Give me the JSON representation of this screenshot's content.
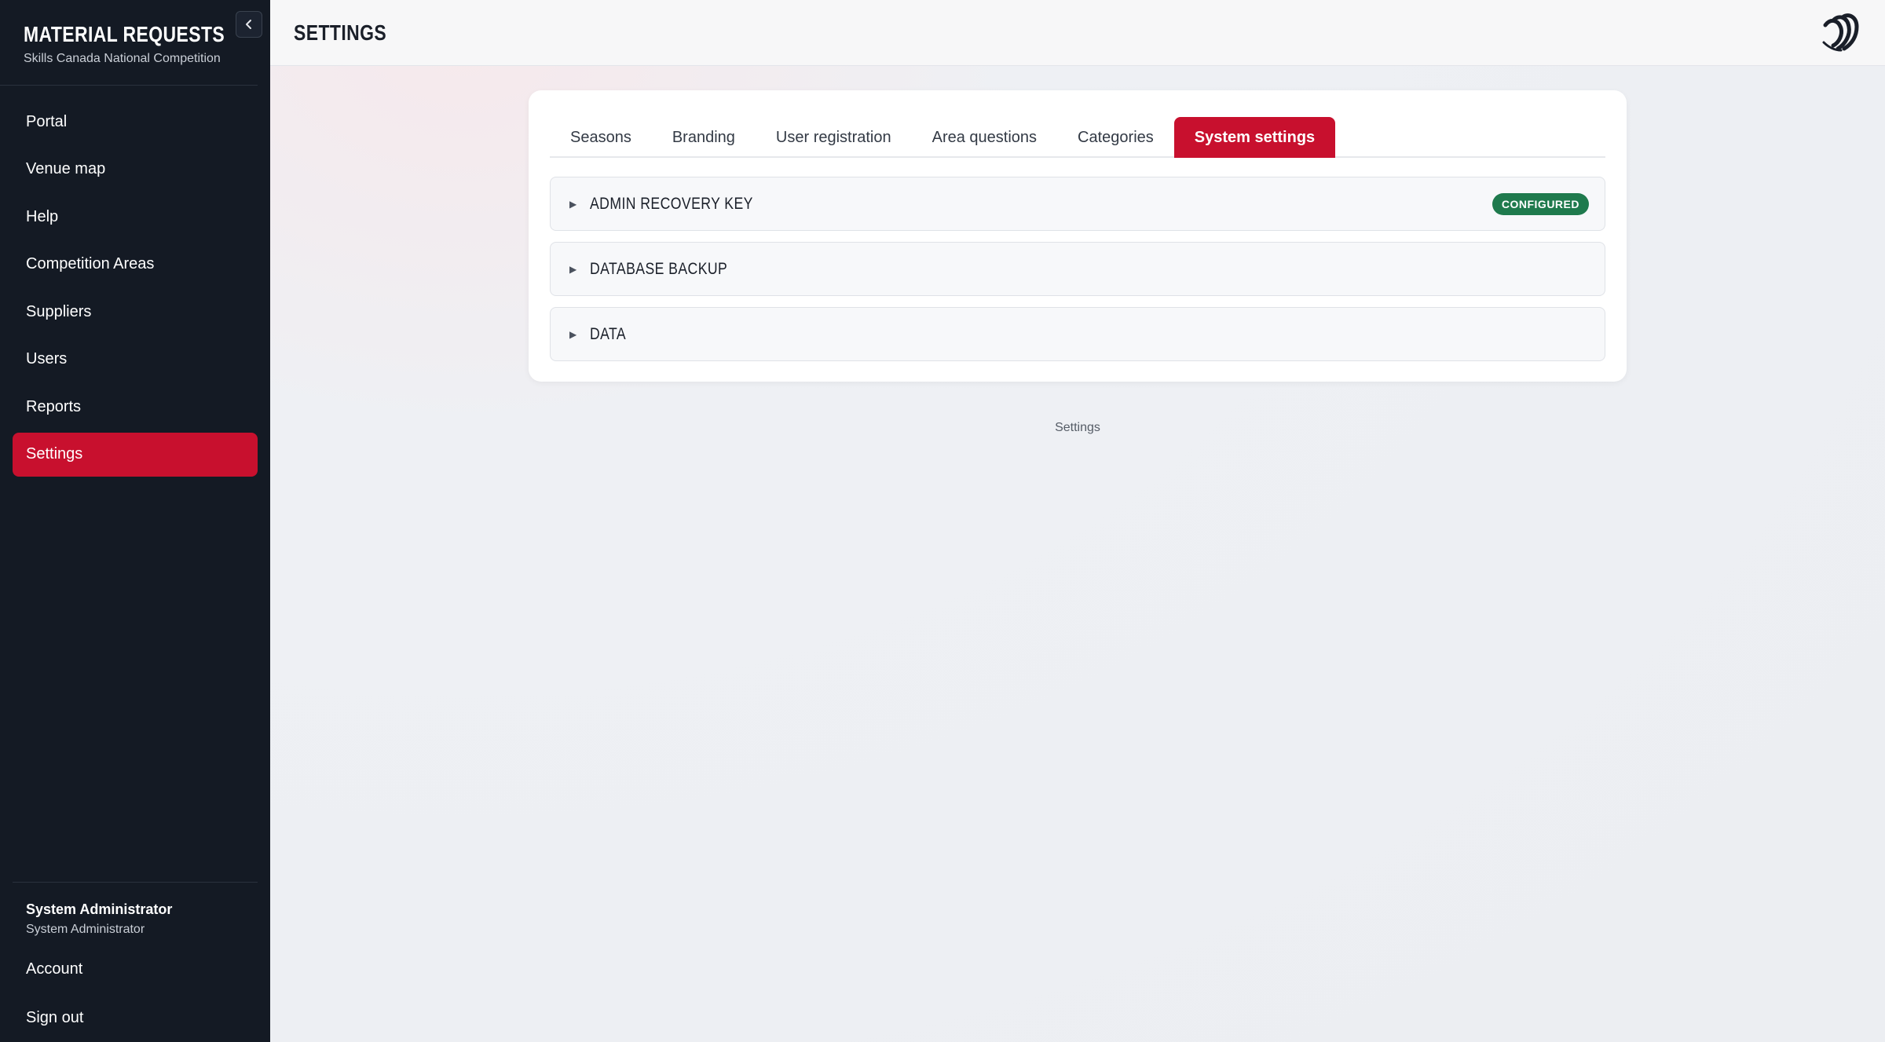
{
  "sidebar": {
    "brand_title": "MATERIAL REQUESTS",
    "brand_subtitle": "Skills Canada National Competition",
    "items": [
      {
        "label": "Portal"
      },
      {
        "label": "Venue map"
      },
      {
        "label": "Help"
      },
      {
        "label": "Competition Areas"
      },
      {
        "label": "Suppliers"
      },
      {
        "label": "Users"
      },
      {
        "label": "Reports"
      },
      {
        "label": "Settings",
        "active": true
      }
    ],
    "user_name": "System Administrator",
    "user_role": "System Administrator",
    "account_label": "Account",
    "signout_label": "Sign out"
  },
  "header": {
    "title": "SETTINGS"
  },
  "tabs": [
    {
      "label": "Seasons"
    },
    {
      "label": "Branding"
    },
    {
      "label": "User registration"
    },
    {
      "label": "Area questions"
    },
    {
      "label": "Categories"
    },
    {
      "label": "System settings",
      "active": true
    }
  ],
  "panels": [
    {
      "title": "ADMIN RECOVERY KEY",
      "badge": "CONFIGURED"
    },
    {
      "title": "DATABASE BACKUP"
    },
    {
      "title": "DATA"
    }
  ],
  "footer": {
    "label": "Settings"
  },
  "colors": {
    "accent": "#c8102e",
    "sidebar_bg": "#141a24",
    "badge_green": "#1f7a4d"
  }
}
